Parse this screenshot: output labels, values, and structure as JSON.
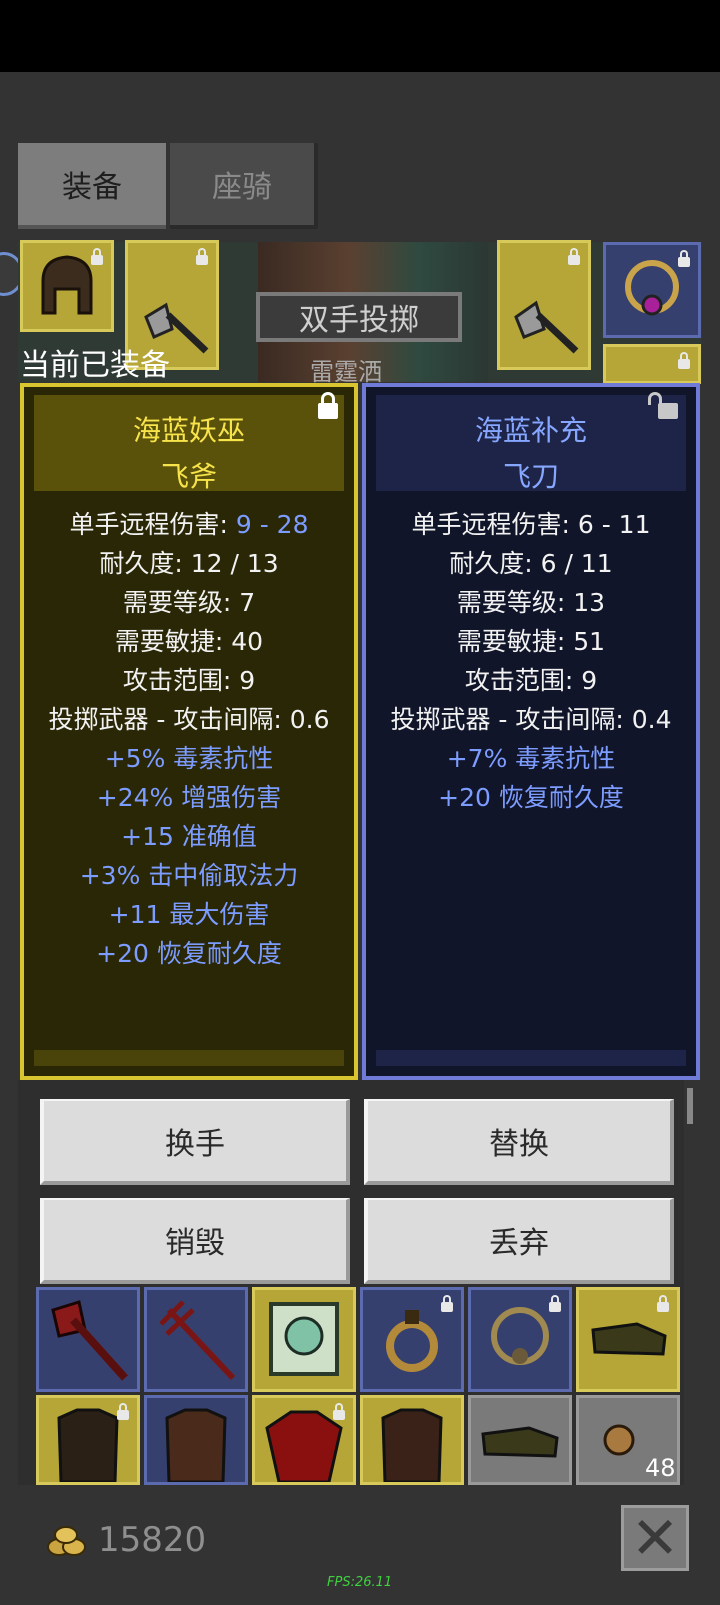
{
  "tabs": [
    {
      "label": "装备"
    },
    {
      "label": "座骑"
    }
  ],
  "header": {
    "equipped_label": "当前已装备",
    "throw_label": "双手投掷",
    "throw_sub": "雷霆洒"
  },
  "left_card": {
    "name_line1": "海蓝妖巫",
    "name_line2": "飞斧",
    "locked": true,
    "stats": [
      {
        "label": "单手远程伤害: ",
        "value": "9 - 28"
      },
      {
        "text": "耐久度: 12 / 13"
      },
      {
        "text": "需要等级: 7"
      },
      {
        "text": "需要敏捷: 40"
      },
      {
        "text": "攻击范围: 9"
      },
      {
        "text": "投掷武器 - 攻击间隔: 0.6"
      }
    ],
    "bonuses": [
      "+5% 毒素抗性",
      "+24% 增强伤害",
      "+15 准确值",
      "+3% 击中偷取法力",
      "+11 最大伤害",
      "+20 恢复耐久度"
    ]
  },
  "right_card": {
    "name_line1": "海蓝补充",
    "name_line2": "飞刀",
    "locked": false,
    "stats": [
      {
        "text": "单手远程伤害: 6 - 11"
      },
      {
        "text": "耐久度: 6 / 11"
      },
      {
        "text": "需要等级: 13"
      },
      {
        "text": "需要敏捷: 51"
      },
      {
        "text": "攻击范围: 9"
      },
      {
        "text": "投掷武器 - 攻击间隔: 0.4"
      }
    ],
    "bonuses": [
      "+7% 毒素抗性",
      "+20 恢复耐久度"
    ]
  },
  "actions": {
    "swap_hand": "换手",
    "replace": "替换",
    "destroy": "销毁",
    "discard": "丢弃"
  },
  "inventory": {
    "stack_count": "48"
  },
  "footer": {
    "gold": "15820",
    "fps": "FPS:26.11"
  },
  "colors": {
    "gold_border": "#d8c52f",
    "blue_border": "#6f7bd6",
    "bonus_text": "#7c9cff",
    "name_gold": "#f7e34a"
  }
}
